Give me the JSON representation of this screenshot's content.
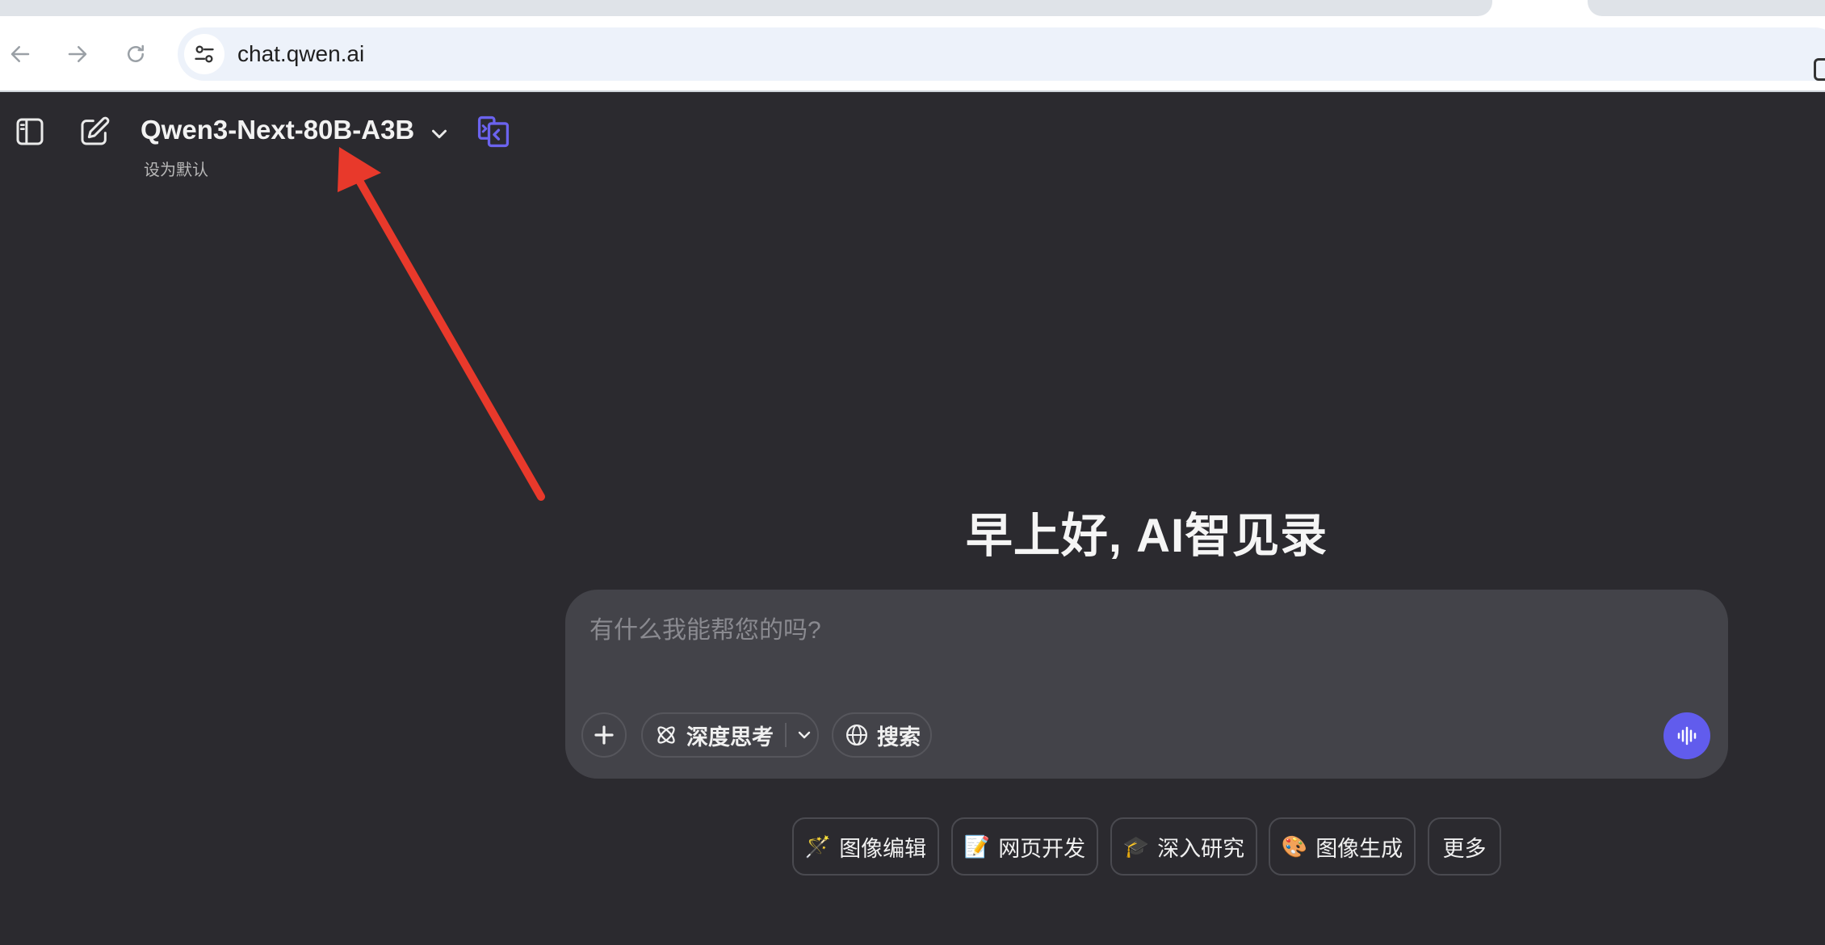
{
  "browser": {
    "url": "chat.qwen.ai"
  },
  "header": {
    "model_name": "Qwen3-Next-80B-A3B",
    "set_default": "设为默认"
  },
  "main": {
    "greeting": "早上好, AI智见录",
    "input_placeholder": "有什么我能帮您的吗?",
    "buttons": {
      "think_label": "深度思考",
      "search_label": "搜索"
    },
    "chips": [
      {
        "icon": "🪄",
        "label": "图像编辑"
      },
      {
        "icon": "📝",
        "label": "网页开发"
      },
      {
        "icon": "🎓",
        "label": "深入研究"
      },
      {
        "icon": "🎨",
        "label": "图像生成"
      },
      {
        "icon": "",
        "label": "更多"
      }
    ]
  },
  "colors": {
    "background": "#2b2a2f",
    "input_box": "#434349",
    "accent": "#615ced",
    "annotation_arrow": "#e8392b"
  }
}
